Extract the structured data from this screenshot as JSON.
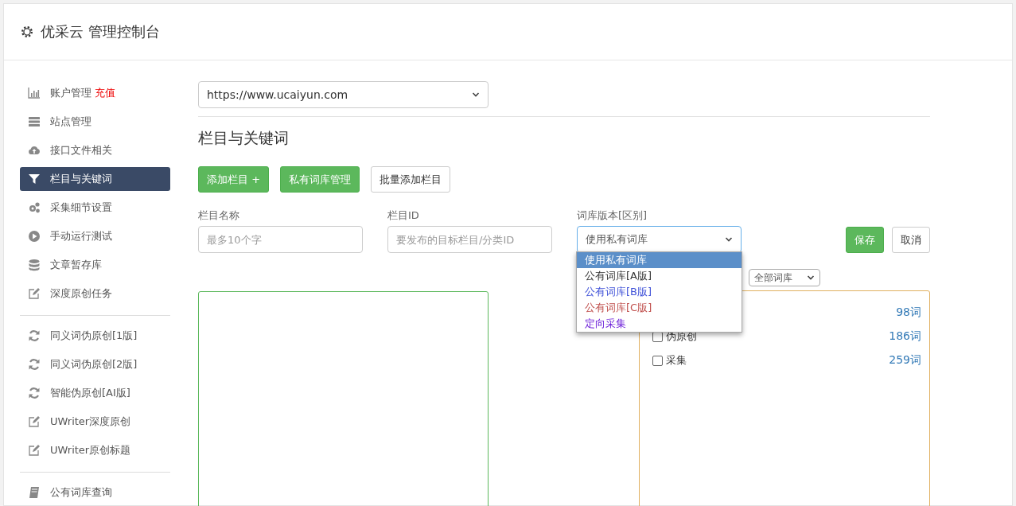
{
  "header": {
    "title": "优采云 管理控制台"
  },
  "sidebar": {
    "groups": [
      {
        "items": [
          {
            "label": "账户管理",
            "badge": "充值",
            "selected": false
          },
          {
            "label": "站点管理",
            "selected": false
          },
          {
            "label": "接口文件相关",
            "selected": false
          },
          {
            "label": "栏目与关键词",
            "selected": true
          },
          {
            "label": "采集细节设置",
            "selected": false
          },
          {
            "label": "手动运行测试",
            "selected": false
          },
          {
            "label": "文章暂存库",
            "selected": false
          },
          {
            "label": "深度原创任务",
            "selected": false
          }
        ]
      },
      {
        "items": [
          {
            "label": "同义词伪原创[1版]",
            "selected": false
          },
          {
            "label": "同义词伪原创[2版]",
            "selected": false
          },
          {
            "label": "智能伪原创[AI版]",
            "selected": false
          },
          {
            "label": "UWriter深度原创",
            "selected": false
          },
          {
            "label": "UWriter原创标题",
            "selected": false
          }
        ]
      },
      {
        "items": [
          {
            "label": "公有词库查询",
            "selected": false
          }
        ]
      }
    ]
  },
  "site_select": {
    "value": "https://www.ucaiyun.com"
  },
  "section_title": "栏目与关键词",
  "buttons": [
    {
      "label": "添加栏目 +",
      "kind": "green"
    },
    {
      "label": "私有词库管理",
      "kind": "green"
    },
    {
      "label": "批量添加栏目",
      "kind": "plain"
    }
  ],
  "form": {
    "fields": [
      {
        "label": "栏目名称",
        "placeholder": "最多10个字",
        "kind": "input"
      },
      {
        "label": "栏目ID",
        "placeholder": "要发布的目标栏目/分类ID",
        "kind": "input"
      },
      {
        "label": "词库版本[区别]",
        "value": "使用私有词库",
        "kind": "select"
      }
    ],
    "save": "保存",
    "cancel": "取消"
  },
  "version_dropdown": {
    "options": [
      {
        "label": "使用私有词库",
        "selected": true,
        "color": "#ffffff"
      },
      {
        "label": "公有词库[A版]",
        "selected": false,
        "color": "#333333"
      },
      {
        "label": "公有词库[B版]",
        "selected": false,
        "color": "#3f51d8"
      },
      {
        "label": "公有词库[C版]",
        "selected": false,
        "color": "#c0504d"
      },
      {
        "label": "定向采集",
        "selected": false,
        "color": "#6a1bd8"
      }
    ]
  },
  "library_filter": {
    "value": "全部词库"
  },
  "library_list": [
    {
      "count": "98词"
    },
    {
      "label": "伪原创",
      "count": "186词",
      "checked": false
    },
    {
      "label": "采集",
      "count": "259词",
      "checked": false
    }
  ]
}
